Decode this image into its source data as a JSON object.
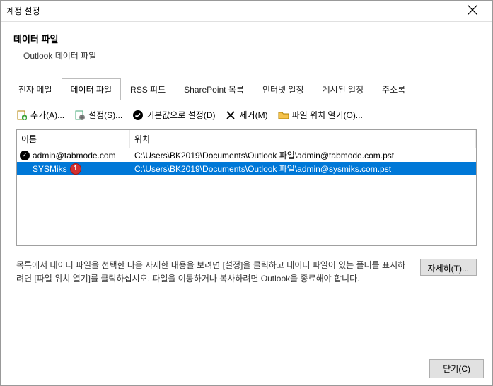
{
  "window": {
    "title": "계정 설정"
  },
  "header": {
    "title": "데이터 파일",
    "subtitle": "Outlook 데이터 파일"
  },
  "tabs": [
    {
      "label": "전자 메일"
    },
    {
      "label": "데이터 파일"
    },
    {
      "label": "RSS 피드"
    },
    {
      "label": "SharePoint 목록"
    },
    {
      "label": "인터넷 일정"
    },
    {
      "label": "게시된 일정"
    },
    {
      "label": "주소록"
    }
  ],
  "toolbar": {
    "add": {
      "prefix": "추가(",
      "hotkey": "A",
      "suffix": ")..."
    },
    "settings": {
      "prefix": "설정(",
      "hotkey": "S",
      "suffix": ")..."
    },
    "default": {
      "prefix": "기본값으로 설정(",
      "hotkey": "D",
      "suffix": ")"
    },
    "remove": {
      "prefix": "제거(",
      "hotkey": "M",
      "suffix": ")"
    },
    "open": {
      "prefix": "파일 위치 열기(",
      "hotkey": "O",
      "suffix": ")..."
    }
  },
  "columns": {
    "name": "이름",
    "location": "위치"
  },
  "rows": [
    {
      "name": "admin@tabmode.com",
      "location": "C:\\Users\\BK2019\\Documents\\Outlook 파일\\admin@tabmode.com.pst",
      "default": true,
      "selected": false,
      "badge": null
    },
    {
      "name": "SYSMiks",
      "location": "C:\\Users\\BK2019\\Documents\\Outlook 파일\\admin@sysmiks.com.pst",
      "default": false,
      "selected": true,
      "badge": "1"
    }
  ],
  "help": {
    "text": "목록에서 데이터 파일을 선택한 다음 자세한 내용을 보려면 [설정]을 클릭하고 데이터 파일이 있는 폴더를 표시하려면 [파일 위치 열기]를 클릭하십시오. 파일을 이동하거나 복사하려면 Outlook을 종료해야 합니다."
  },
  "buttons": {
    "detail": {
      "prefix": "자세히(",
      "hotkey": "T",
      "suffix": ")..."
    },
    "close": {
      "prefix": "닫기(",
      "hotkey": "C",
      "suffix": ")"
    }
  }
}
